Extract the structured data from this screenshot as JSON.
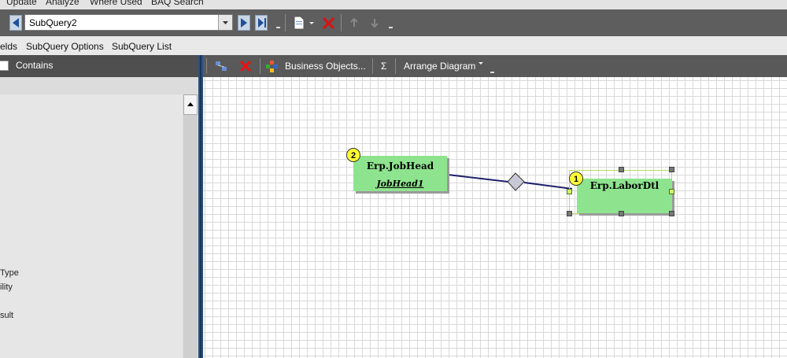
{
  "menu": {
    "items": [
      "Update",
      "Analyze",
      "Where Used",
      "BAQ Search"
    ]
  },
  "toolbar": {
    "subquery_value": "SubQuery2"
  },
  "tabs": [
    "elds",
    "SubQuery Options",
    "SubQuery List"
  ],
  "left_panel": {
    "contains_label": "Contains",
    "properties": [
      "Type",
      "ility",
      "sult"
    ]
  },
  "diagram_toolbar": {
    "business_objects": "Business Objects...",
    "sum_symbol": "Σ",
    "arrange_diagram": "Arrange Diagram"
  },
  "diagram": {
    "tables": [
      {
        "order": "2",
        "name": "Erp.JobHead",
        "alias": "JobHead1"
      },
      {
        "order": "1",
        "name": "Erp.LaborDtl",
        "alias": ""
      }
    ]
  },
  "colors": {
    "table_fill": "#8ee48e",
    "badge": "#ffff33",
    "link": "#1f1f6b"
  }
}
